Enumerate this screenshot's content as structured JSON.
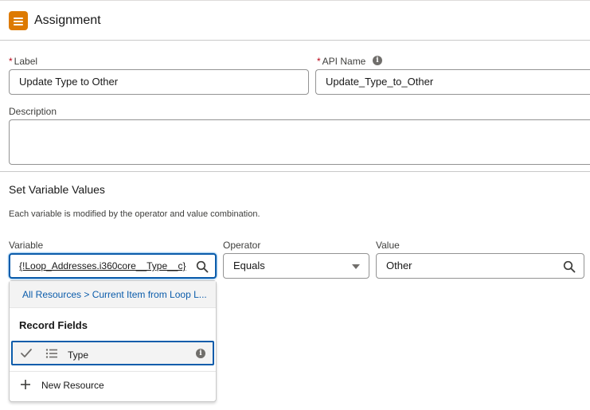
{
  "header": {
    "title": "Assignment",
    "icon": "assignment-icon",
    "icon_color": "#dd7a01"
  },
  "form": {
    "label": {
      "label": "Label",
      "required_marker": "*",
      "value": "Update Type to Other"
    },
    "api_name": {
      "label": "API Name",
      "required_marker": "*",
      "value": "Update_Type_to_Other",
      "info_glyph": "i"
    },
    "description": {
      "label": "Description",
      "value": ""
    }
  },
  "section": {
    "title": "Set Variable Values",
    "help": "Each variable is modified by the operator and value combination."
  },
  "row": {
    "variable": {
      "label": "Variable",
      "value": "{!Loop_Addresses.i360core__Type__c}"
    },
    "operator": {
      "label": "Operator",
      "value": "Equals"
    },
    "value": {
      "label": "Value",
      "value": "Other"
    }
  },
  "dropdown": {
    "breadcrumb": "All Resources > Current Item from Loop L...",
    "heading": "Record Fields",
    "items": [
      {
        "label": "Type",
        "selected": true,
        "info_glyph": "i"
      }
    ],
    "new_resource": "New Resource"
  },
  "colors": {
    "accent": "#0b5cab",
    "required": "#ba0517",
    "border": "#939393"
  }
}
